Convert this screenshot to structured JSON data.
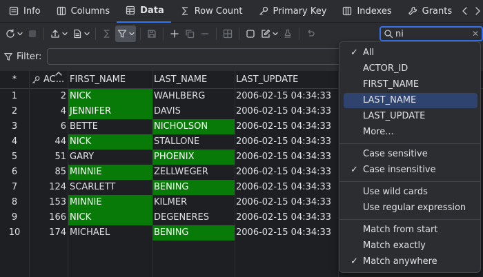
{
  "tabs": [
    {
      "label": "Info",
      "icon": "info-icon"
    },
    {
      "label": "Columns",
      "icon": "columns-icon"
    },
    {
      "label": "Data",
      "icon": "table-icon",
      "active": true
    },
    {
      "label": "Row Count",
      "icon": "sigma-icon"
    },
    {
      "label": "Primary Key",
      "icon": "key-icon"
    },
    {
      "label": "Indexes",
      "icon": "index-icon"
    },
    {
      "label": "Grants",
      "icon": "wrench-icon"
    }
  ],
  "search": {
    "value": "ni",
    "placeholder": ""
  },
  "filter": {
    "label": "Filter:",
    "value": ""
  },
  "grid": {
    "corner": "*",
    "columns": [
      "AC...",
      "FIRST_NAME",
      "LAST_NAME",
      "LAST_UPDATE"
    ],
    "rows": [
      {
        "n": "1",
        "id": "2",
        "first": "NICK",
        "last": "WAHLBERG",
        "upd": "2006-02-15 04:34:33",
        "hf": true,
        "hl": false
      },
      {
        "n": "2",
        "id": "4",
        "first": "JENNIFER",
        "last": "DAVIS",
        "upd": "2006-02-15 04:34:33",
        "hf": true,
        "hl": false
      },
      {
        "n": "3",
        "id": "6",
        "first": "BETTE",
        "last": "NICHOLSON",
        "upd": "2006-02-15 04:34:33",
        "hf": false,
        "hl": true
      },
      {
        "n": "4",
        "id": "44",
        "first": "NICK",
        "last": "STALLONE",
        "upd": "2006-02-15 04:34:33",
        "hf": true,
        "hl": false
      },
      {
        "n": "5",
        "id": "51",
        "first": "GARY",
        "last": "PHOENIX",
        "upd": "2006-02-15 04:34:33",
        "hf": false,
        "hl": true
      },
      {
        "n": "6",
        "id": "85",
        "first": "MINNIE",
        "last": "ZELLWEGER",
        "upd": "2006-02-15 04:34:33",
        "hf": true,
        "hl": false
      },
      {
        "n": "7",
        "id": "124",
        "first": "SCARLETT",
        "last": "BENING",
        "upd": "2006-02-15 04:34:33",
        "hf": false,
        "hl": true
      },
      {
        "n": "8",
        "id": "153",
        "first": "MINNIE",
        "last": "KILMER",
        "upd": "2006-02-15 04:34:33",
        "hf": true,
        "hl": false
      },
      {
        "n": "9",
        "id": "166",
        "first": "NICK",
        "last": "DEGENERES",
        "upd": "2006-02-15 04:34:33",
        "hf": true,
        "hl": false
      },
      {
        "n": "10",
        "id": "174",
        "first": "MICHAEL",
        "last": "BENING",
        "upd": "2006-02-15 04:34:33",
        "hf": false,
        "hl": true
      }
    ]
  },
  "menu": {
    "groups": [
      [
        {
          "label": "All",
          "checked": true
        },
        {
          "label": "ACTOR_ID"
        },
        {
          "label": "FIRST_NAME"
        },
        {
          "label": "LAST_NAME",
          "selected": true
        },
        {
          "label": "LAST_UPDATE"
        },
        {
          "label": "More..."
        }
      ],
      [
        {
          "label": "Case sensitive"
        },
        {
          "label": "Case insensitive",
          "checked": true
        }
      ],
      [
        {
          "label": "Use wild cards"
        },
        {
          "label": "Use regular expression"
        }
      ],
      [
        {
          "label": "Match from start"
        },
        {
          "label": "Match exactly"
        },
        {
          "label": "Match anywhere",
          "checked": true
        }
      ]
    ]
  },
  "colors": {
    "highlight": "#077a07",
    "accent": "#3574f0",
    "selection": "#2e436e"
  }
}
